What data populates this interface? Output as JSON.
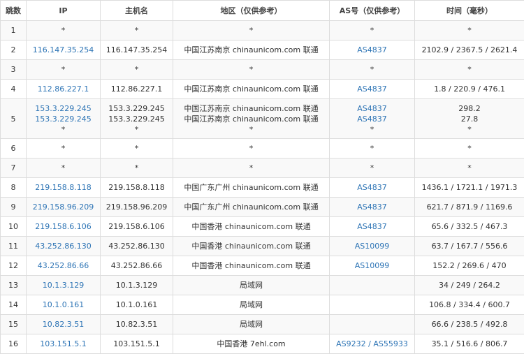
{
  "headers": [
    "跳数",
    "IP",
    "主机名",
    "地区（仅供参考）",
    "AS号（仅供参考）",
    "时间（毫秒）"
  ],
  "rows": [
    {
      "hop": "1",
      "ip": [
        "*"
      ],
      "host": [
        "*"
      ],
      "region": [
        "*"
      ],
      "as": [
        "*"
      ],
      "time": [
        "*"
      ]
    },
    {
      "hop": "2",
      "ip": [
        "116.147.35.254"
      ],
      "host": [
        "116.147.35.254"
      ],
      "region": [
        "中国江苏南京 chinaunicom.com 联通"
      ],
      "as": [
        "AS4837"
      ],
      "time": [
        "2102.9 / 2367.5 / 2621.4"
      ]
    },
    {
      "hop": "3",
      "ip": [
        "*"
      ],
      "host": [
        "*"
      ],
      "region": [
        "*"
      ],
      "as": [
        "*"
      ],
      "time": [
        "*"
      ]
    },
    {
      "hop": "4",
      "ip": [
        "112.86.227.1"
      ],
      "host": [
        "112.86.227.1"
      ],
      "region": [
        "中国江苏南京 chinaunicom.com 联通"
      ],
      "as": [
        "AS4837"
      ],
      "time": [
        "1.8 / 220.9 / 476.1"
      ]
    },
    {
      "hop": "5",
      "ip": [
        "153.3.229.245",
        "153.3.229.245",
        "*"
      ],
      "host": [
        "153.3.229.245",
        "153.3.229.245",
        "*"
      ],
      "region": [
        "中国江苏南京 chinaunicom.com 联通",
        "中国江苏南京 chinaunicom.com 联通",
        "*"
      ],
      "as": [
        "AS4837",
        "AS4837",
        "*"
      ],
      "time": [
        "298.2",
        "27.8",
        "*"
      ]
    },
    {
      "hop": "6",
      "ip": [
        "*"
      ],
      "host": [
        "*"
      ],
      "region": [
        "*"
      ],
      "as": [
        "*"
      ],
      "time": [
        "*"
      ]
    },
    {
      "hop": "7",
      "ip": [
        "*"
      ],
      "host": [
        "*"
      ],
      "region": [
        "*"
      ],
      "as": [
        "*"
      ],
      "time": [
        "*"
      ]
    },
    {
      "hop": "8",
      "ip": [
        "219.158.8.118"
      ],
      "host": [
        "219.158.8.118"
      ],
      "region": [
        "中国广东广州 chinaunicom.com 联通"
      ],
      "as": [
        "AS4837"
      ],
      "time": [
        "1436.1 / 1721.1 / 1971.3"
      ]
    },
    {
      "hop": "9",
      "ip": [
        "219.158.96.209"
      ],
      "host": [
        "219.158.96.209"
      ],
      "region": [
        "中国广东广州 chinaunicom.com 联通"
      ],
      "as": [
        "AS4837"
      ],
      "time": [
        "621.7 / 871.9 / 1169.6"
      ]
    },
    {
      "hop": "10",
      "ip": [
        "219.158.6.106"
      ],
      "host": [
        "219.158.6.106"
      ],
      "region": [
        "中国香港 chinaunicom.com 联通"
      ],
      "as": [
        "AS4837"
      ],
      "time": [
        "65.6 / 332.5 / 467.3"
      ]
    },
    {
      "hop": "11",
      "ip": [
        "43.252.86.130"
      ],
      "host": [
        "43.252.86.130"
      ],
      "region": [
        "中国香港 chinaunicom.com 联通"
      ],
      "as": [
        "AS10099"
      ],
      "time": [
        "63.7 / 167.7 / 556.6"
      ]
    },
    {
      "hop": "12",
      "ip": [
        "43.252.86.66"
      ],
      "host": [
        "43.252.86.66"
      ],
      "region": [
        "中国香港 chinaunicom.com 联通"
      ],
      "as": [
        "AS10099"
      ],
      "time": [
        "152.2 / 269.6 / 470"
      ]
    },
    {
      "hop": "13",
      "ip": [
        "10.1.3.129"
      ],
      "host": [
        "10.1.3.129"
      ],
      "region": [
        "局域网"
      ],
      "as": [
        ""
      ],
      "time": [
        "34 / 249 / 264.2"
      ]
    },
    {
      "hop": "14",
      "ip": [
        "10.1.0.161"
      ],
      "host": [
        "10.1.0.161"
      ],
      "region": [
        "局域网"
      ],
      "as": [
        ""
      ],
      "time": [
        "106.8 / 334.4 / 600.7"
      ]
    },
    {
      "hop": "15",
      "ip": [
        "10.82.3.51"
      ],
      "host": [
        "10.82.3.51"
      ],
      "region": [
        "局域网"
      ],
      "as": [
        ""
      ],
      "time": [
        "66.6 / 238.5 / 492.8"
      ]
    },
    {
      "hop": "16",
      "ip": [
        "103.151.5.1"
      ],
      "host": [
        "103.151.5.1"
      ],
      "region": [
        "中国香港 7ehl.com"
      ],
      "as": [
        "AS9232 / AS55933"
      ],
      "time": [
        "35.1 / 516.6 / 806.7"
      ]
    }
  ],
  "colors": {
    "link": "#2d74b5",
    "border": "#dddddd",
    "stripe": "#f9f9f9"
  }
}
